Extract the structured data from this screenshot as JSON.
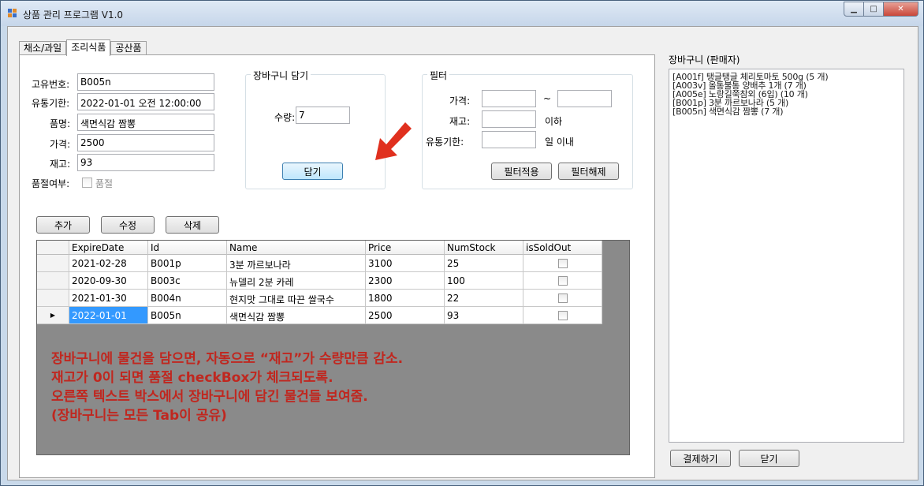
{
  "window": {
    "title": "상품 관리 프로그램 V1.0"
  },
  "tabs": [
    {
      "label": "채소/과일",
      "active": false
    },
    {
      "label": "조리식품",
      "active": true
    },
    {
      "label": "공산품",
      "active": false
    }
  ],
  "form": {
    "id_label": "고유번호:",
    "id_value": "B005n",
    "expire_label": "유통기한:",
    "expire_value": "2022-01-01 오전 12:00:00",
    "name_label": "품명:",
    "name_value": "색면식감 짬뽕",
    "price_label": "가격:",
    "price_value": "2500",
    "stock_label": "재고:",
    "stock_value": "93",
    "soldout_label": "품절여부:",
    "soldout_check_label": "품절",
    "soldout_checked": false
  },
  "cart_group": {
    "title": "장바구니 담기",
    "qty_label": "수량:",
    "qty_value": "7",
    "add_button": "담기"
  },
  "filter": {
    "title": "필터",
    "price_label": "가격:",
    "tilde": "~",
    "price_min": "",
    "price_max": "",
    "stock_label": "재고:",
    "stock_value": "",
    "stock_suffix": "이하",
    "expire_label": "유통기한:",
    "expire_value": "",
    "expire_suffix": "일 이내",
    "apply_button": "필터적용",
    "clear_button": "필터해제"
  },
  "actions": {
    "add": "추가",
    "edit": "수정",
    "delete": "삭제"
  },
  "grid": {
    "columns": [
      "ExpireDate",
      "Id",
      "Name",
      "Price",
      "NumStock",
      "isSoldOut"
    ],
    "rows": [
      {
        "expire": "2021-02-28",
        "id": "B001p",
        "name": "3분 까르보나라",
        "price": "3100",
        "stock": "25",
        "soldout": false,
        "current": false
      },
      {
        "expire": "2020-09-30",
        "id": "B003c",
        "name": "뉴델리 2분 카레",
        "price": "2300",
        "stock": "100",
        "soldout": false,
        "current": false
      },
      {
        "expire": "2021-01-30",
        "id": "B004n",
        "name": "현지맛 그대로 따끈 쌀국수",
        "price": "1800",
        "stock": "22",
        "soldout": false,
        "current": false
      },
      {
        "expire": "2022-01-01",
        "id": "B005n",
        "name": "색면식감 짬뽕",
        "price": "2500",
        "stock": "93",
        "soldout": false,
        "current": true
      }
    ],
    "current_row_marker": "▶"
  },
  "annotation": {
    "lines": [
      "장바구니에 물건을 담으면, 자동으로 “재고”가 수량만큼 감소.",
      "재고가 0이 되면 품절 checkBox가 체크되도록.",
      "오른쪽 텍스트 박스에서 장바구니에 담긴 물건들 보여줌.",
      "(장바구니는 모든 Tab이 공유)"
    ],
    "color": "#c0271f"
  },
  "cart_panel": {
    "label": "장바구니 (판매자)",
    "items": [
      "[A001f] 탱글탱글 체리토마토 500g (5 개)",
      "[A003v] 올통불통 양배추 1개 (7 개)",
      "[A005e] 노랑길쭉참외 (6입) (10 개)",
      "[B001p] 3분 까르보나라 (5 개)",
      "[B005n] 색면식감 짬뽕 (7 개)"
    ],
    "pay_button": "결제하기",
    "close_button": "닫기"
  },
  "colors": {
    "selection": "#3399ff",
    "arrow": "#e0301e"
  }
}
